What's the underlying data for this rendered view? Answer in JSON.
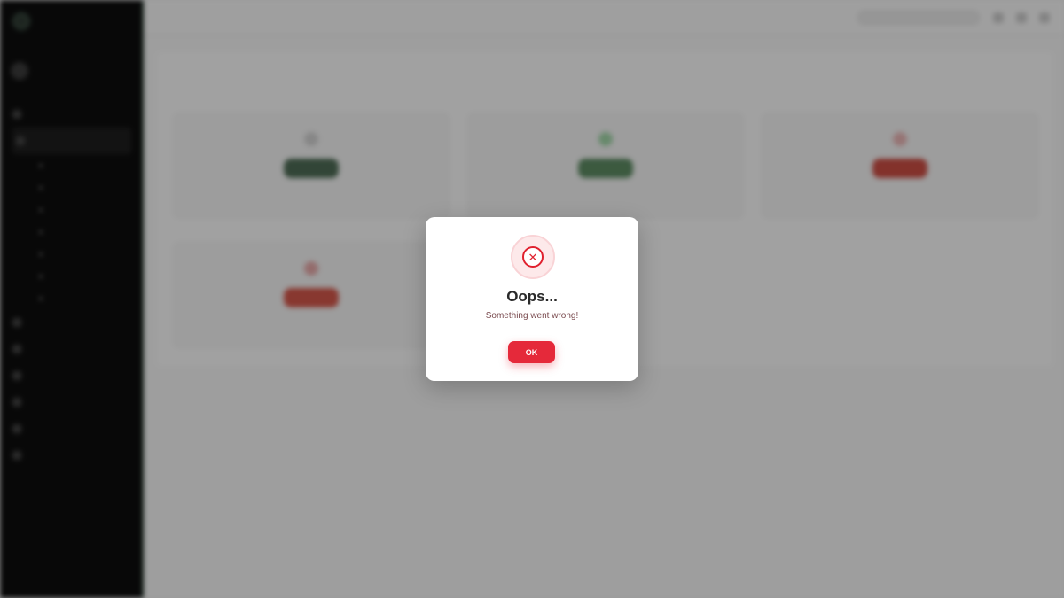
{
  "app": {
    "brand": "",
    "user_name": "",
    "page_title": "",
    "search_placeholder": "",
    "sidebar_items": [
      "",
      "",
      "",
      "",
      "",
      "",
      "",
      ""
    ],
    "sidebar_subitems": [
      "",
      "",
      "",
      "",
      "",
      "",
      ""
    ],
    "tiles": [
      {
        "name": "",
        "desc": "",
        "tone": "neutral"
      },
      {
        "name": "",
        "desc": "",
        "tone": "success"
      },
      {
        "name": "",
        "desc": "",
        "tone": "danger"
      },
      {
        "name": "",
        "desc": "",
        "tone": "danger"
      }
    ],
    "footer_links": [
      "",
      "",
      "",
      ""
    ],
    "footer_right": ""
  },
  "modal": {
    "title": "Oops...",
    "message": "Something went wrong!",
    "ok_label": "OK",
    "icon": "x-circle-icon"
  },
  "colors": {
    "danger": "#e5293a",
    "danger_soft": "#fde9ea",
    "sidebar_bg": "#0d0d0d",
    "overlay": "rgba(0,0,0,0.35)"
  }
}
